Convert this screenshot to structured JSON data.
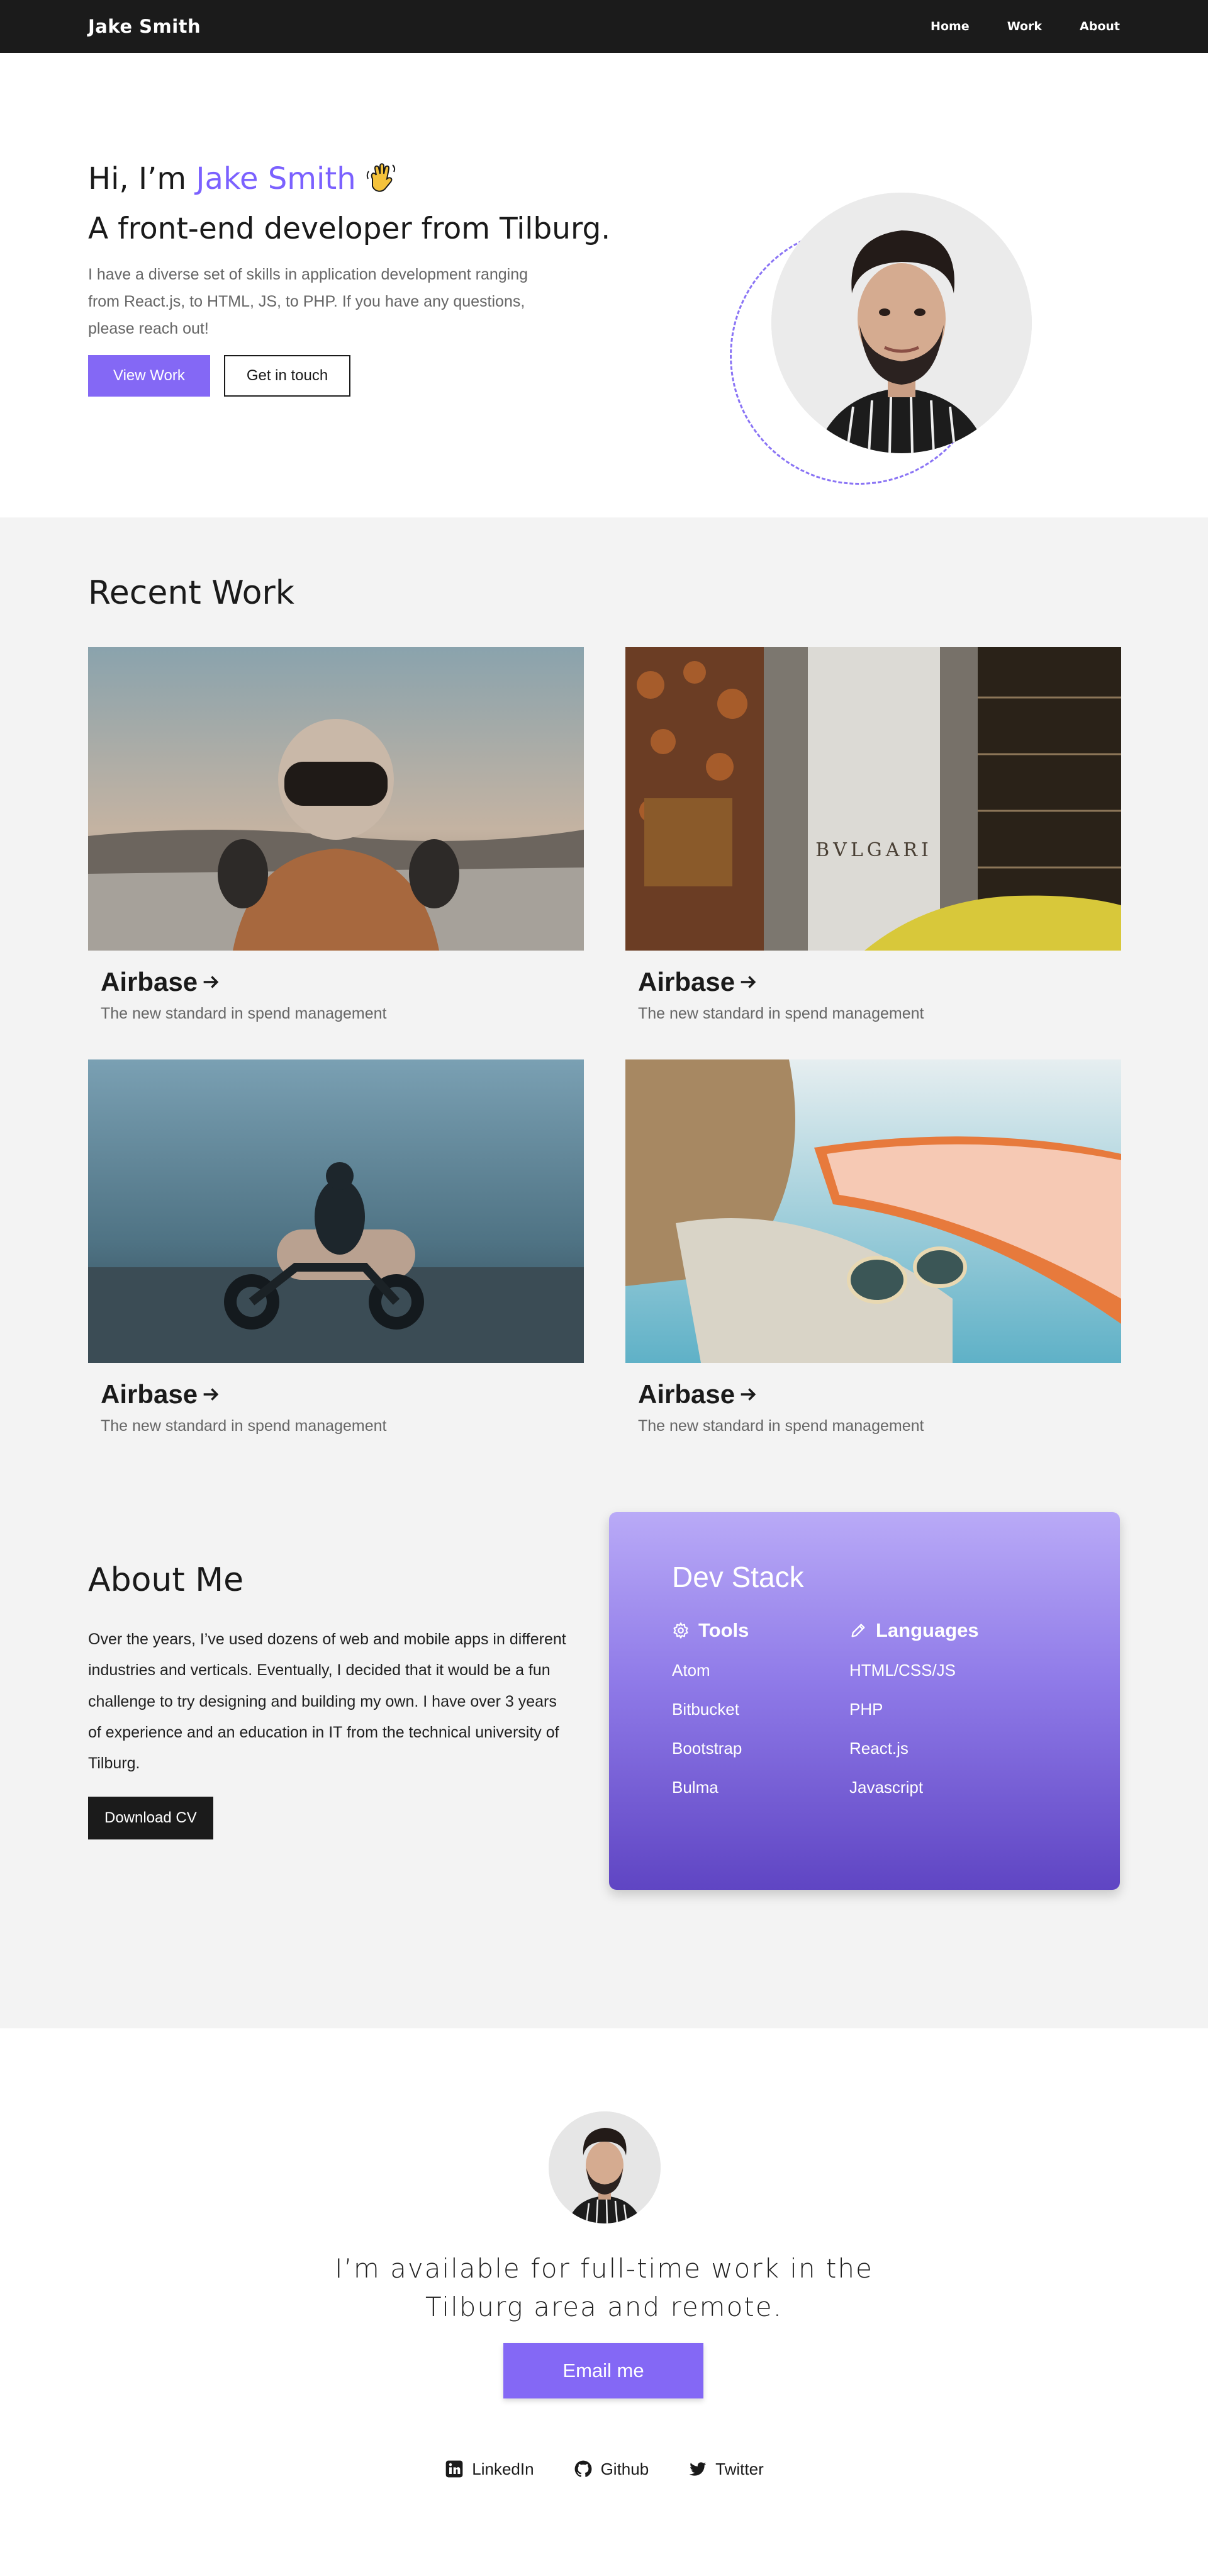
{
  "navbar": {
    "brand": "Jake Smith",
    "links": [
      "Home",
      "Work",
      "About"
    ]
  },
  "hero": {
    "greeting_prefix": "Hi, I’m ",
    "greeting_name": "Jake Smith",
    "subtitle": "A front-end developer from Tilburg.",
    "description": "I have a diverse set of skills in application development ranging from React.js, to HTML, JS, to PHP. If you have any questions, please reach out!",
    "primary_button": "View Work",
    "secondary_button": "Get in touch",
    "accent_color": "#7b61ff",
    "wave_icon": "waving-hand-icon"
  },
  "work": {
    "title": "Recent Work",
    "projects": [
      {
        "title": "Airbase",
        "description": "The new standard in spend management",
        "image": "astronaut-helmet-photo"
      },
      {
        "title": "Airbase",
        "description": "The new standard in spend management",
        "image": "bvlgari-storefront-photo"
      },
      {
        "title": "Airbase",
        "description": "The new standard in spend management",
        "image": "motorcycle-beach-photo"
      },
      {
        "title": "Airbase",
        "description": "The new standard in spend management",
        "image": "sunglasses-surfboard-photo"
      }
    ],
    "store_sign": "BVLGARI"
  },
  "about": {
    "title": "About Me",
    "text": "Over the years, I’ve used dozens of web and mobile apps in different industries and verticals. Eventually, I decided that it would be a fun challenge to try designing and building my own. I have over 3 years of experience and an education in IT from the technical university of Tilburg.",
    "button": "Download CV",
    "stack": {
      "title": "Dev Stack",
      "tools_title": "Tools",
      "tools": [
        "Atom",
        "Bitbucket",
        "Bootstrap",
        "Bulma"
      ],
      "languages_title": "Languages",
      "languages": [
        "HTML/CSS/JS",
        "PHP",
        "React.js",
        "Javascript"
      ]
    }
  },
  "contact": {
    "text": "I’m available for full-time work in the Tilburg area and remote.",
    "button": "Email me",
    "socials": [
      {
        "label": "LinkedIn",
        "icon": "linkedin-icon"
      },
      {
        "label": "Github",
        "icon": "github-icon"
      },
      {
        "label": "Twitter",
        "icon": "twitter-icon"
      }
    ]
  }
}
